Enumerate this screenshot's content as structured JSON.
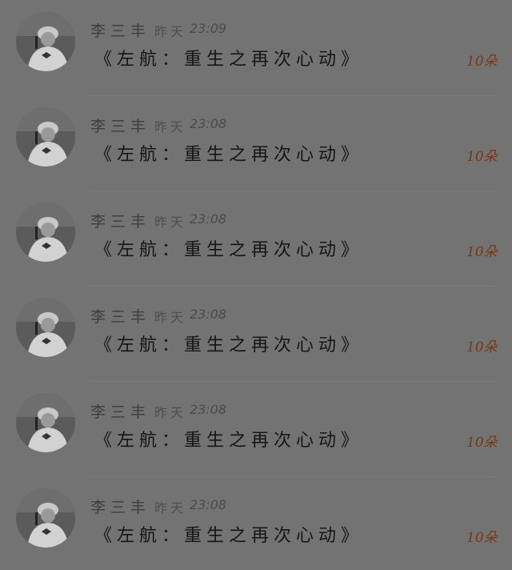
{
  "colors": {
    "background": "#737373",
    "name": "#3e3e3e",
    "title": "#151515",
    "count": "#7a3614"
  },
  "messages": [
    {
      "author": "李三丰",
      "day": "昨天",
      "time": "23:09",
      "title": "《左航：重生之再次心动》",
      "count": "10朵",
      "avatar_icon": "user-avatar-icon"
    },
    {
      "author": "李三丰",
      "day": "昨天",
      "time": "23:08",
      "title": "《左航：重生之再次心动》",
      "count": "10朵",
      "avatar_icon": "user-avatar-icon"
    },
    {
      "author": "李三丰",
      "day": "昨天",
      "time": "23:08",
      "title": "《左航：重生之再次心动》",
      "count": "10朵",
      "avatar_icon": "user-avatar-icon"
    },
    {
      "author": "李三丰",
      "day": "昨天",
      "time": "23:08",
      "title": "《左航：重生之再次心动》",
      "count": "10朵",
      "avatar_icon": "user-avatar-icon"
    },
    {
      "author": "李三丰",
      "day": "昨天",
      "time": "23:08",
      "title": "《左航：重生之再次心动》",
      "count": "10朵",
      "avatar_icon": "user-avatar-icon"
    },
    {
      "author": "李三丰",
      "day": "昨天",
      "time": "23:08",
      "title": "《左航：重生之再次心动》",
      "count": "10朵",
      "avatar_icon": "user-avatar-icon"
    }
  ]
}
